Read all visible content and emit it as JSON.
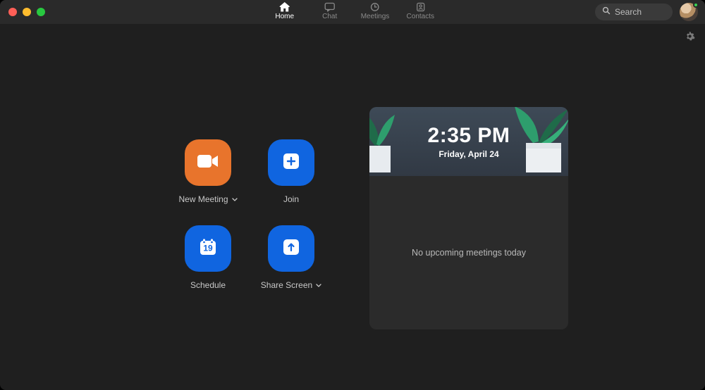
{
  "colors": {
    "orange": "#e8742c",
    "blue": "#1065e0",
    "bg": "#1f1f1f",
    "panel": "#2b2b2b"
  },
  "nav": {
    "items": [
      {
        "label": "Home",
        "active": true
      },
      {
        "label": "Chat",
        "active": false
      },
      {
        "label": "Meetings",
        "active": false
      },
      {
        "label": "Contacts",
        "active": false
      }
    ]
  },
  "search": {
    "placeholder": "Search"
  },
  "actions": {
    "new_meeting": {
      "label": "New Meeting"
    },
    "join": {
      "label": "Join"
    },
    "schedule": {
      "label": "Schedule",
      "calendar_day": "19"
    },
    "share_screen": {
      "label": "Share Screen"
    }
  },
  "panel": {
    "time": "2:35 PM",
    "date": "Friday, April 24",
    "empty_text": "No upcoming meetings today"
  }
}
